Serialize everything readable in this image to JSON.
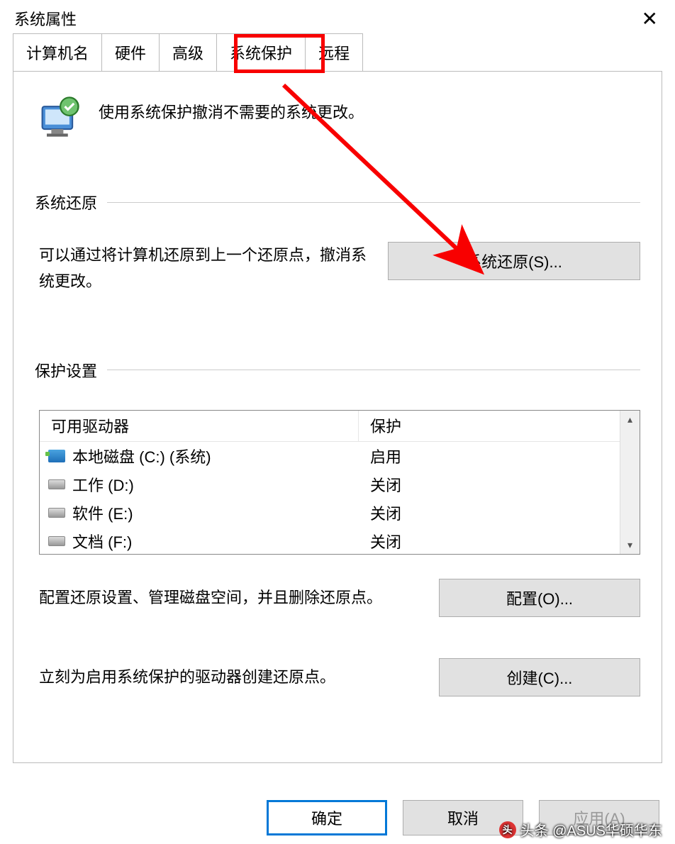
{
  "window": {
    "title": "系统属性"
  },
  "tabs": {
    "computer_name": "计算机名",
    "hardware": "硬件",
    "advanced": "高级",
    "system_protection": "系统保护",
    "remote": "远程"
  },
  "intro": {
    "text": "使用系统保护撤消不需要的系统更改。"
  },
  "restore": {
    "heading": "系统还原",
    "description": "可以通过将计算机还原到上一个还原点，撤消系统更改。",
    "button": "系统还原(S)..."
  },
  "protection": {
    "heading": "保护设置",
    "col_drive": "可用驱动器",
    "col_protect": "保护",
    "drives": [
      {
        "name": "本地磁盘 (C:) (系统)",
        "status": "启用",
        "icon": "sys"
      },
      {
        "name": "工作 (D:)",
        "status": "关闭",
        "icon": "hdd"
      },
      {
        "name": "软件 (E:)",
        "status": "关闭",
        "icon": "hdd"
      },
      {
        "name": "文档 (F:)",
        "status": "关闭",
        "icon": "hdd"
      }
    ],
    "configure_desc": "配置还原设置、管理磁盘空间，并且删除还原点。",
    "configure_btn": "配置(O)...",
    "create_desc": "立刻为启用系统保护的驱动器创建还原点。",
    "create_btn": "创建(C)..."
  },
  "actions": {
    "ok": "确定",
    "cancel": "取消",
    "apply": "应用(A)"
  },
  "watermark": "头条 @ASUS华硕华东"
}
